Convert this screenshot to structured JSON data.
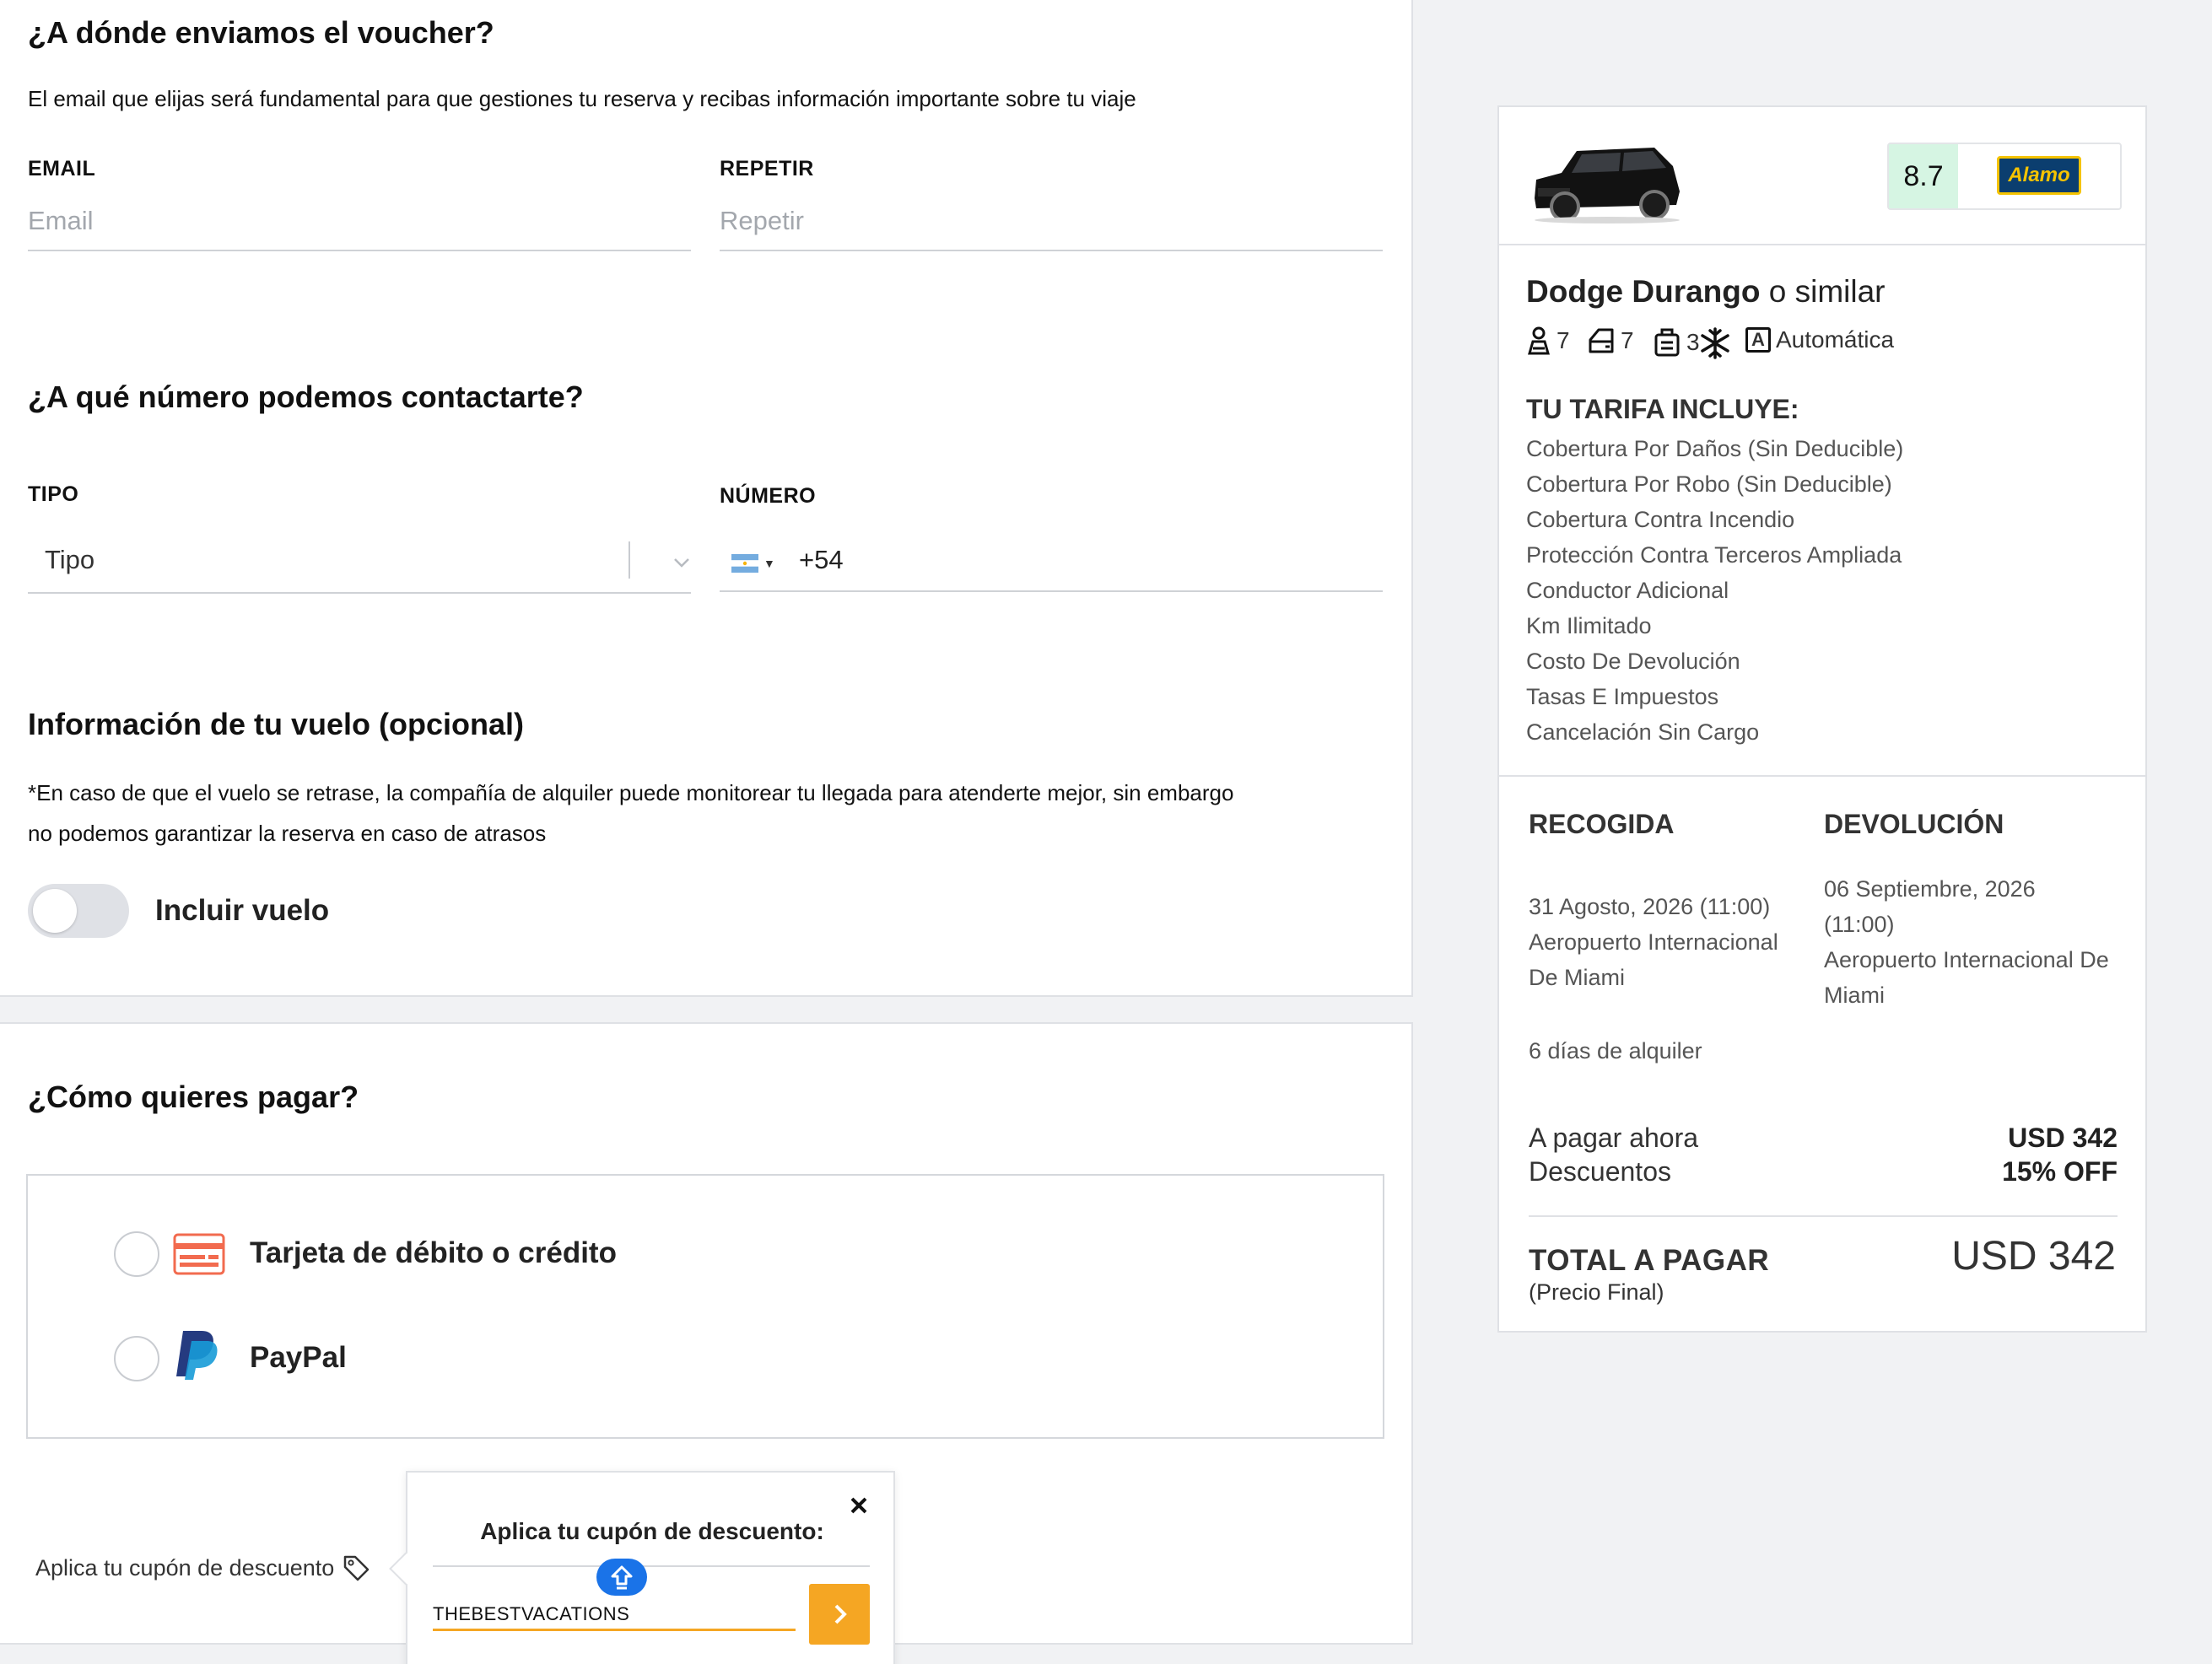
{
  "voucher": {
    "title": "¿A dónde enviamos el voucher?",
    "description": "El email que elijas será fundamental para que gestiones tu reserva y recibas información importante sobre tu viaje",
    "email_label": "EMAIL",
    "email_placeholder": "Email",
    "repeat_label": "REPETIR",
    "repeat_placeholder": "Repetir"
  },
  "contact": {
    "title": "¿A qué número podemos contactarte?",
    "type_label": "TIPO",
    "type_value": "Tipo",
    "number_label": "NÚMERO",
    "country_prefix": "+54"
  },
  "flight": {
    "title": "Información de tu vuelo (opcional)",
    "note_line1": "*En caso de que el vuelo se retrase, la compañía de alquiler puede monitorear tu llegada para atenderte mejor, sin embargo",
    "note_line2": "no podemos garantizar la reserva en caso de atrasos",
    "toggle_label": "Incluir vuelo",
    "toggle_on": false
  },
  "payment": {
    "title": "¿Cómo quieres pagar?",
    "options": [
      {
        "label": "Tarjeta de débito o crédito",
        "icon": "credit-card-icon"
      },
      {
        "label": "PayPal",
        "icon": "paypal-icon"
      }
    ]
  },
  "coupon": {
    "link_label": "Aplica tu cupón de descuento",
    "popover_title": "Aplica tu cupón de descuento:",
    "code_value": "THEBESTVACATIONS"
  },
  "summary": {
    "rating": "8.7",
    "vendor": "Alamo",
    "car_model": "Dodge Durango",
    "car_suffix": " o similar",
    "specs": {
      "passengers": "7",
      "doors": "7",
      "bags": "3",
      "transmission": "Automática",
      "transmission_badge": "A"
    },
    "includes_title": "TU TARIFA INCLUYE:",
    "includes": [
      "Cobertura Por Daños (Sin Deducible)",
      "Cobertura Por Robo (Sin Deducible)",
      "Cobertura Contra Incendio",
      "Protección Contra Terceros Ampliada",
      "Conductor Adicional",
      "Km Ilimitado",
      "Costo De Devolución",
      "Tasas E Impuestos",
      "Cancelación Sin Cargo"
    ],
    "pickup_title": "RECOGIDA",
    "pickup_date": "31 Agosto, 2026 (11:00)",
    "pickup_place": "Aeropuerto Internacional De Miami",
    "return_title": "DEVOLUCIÓN",
    "return_date": "06 Septiembre, 2026 (11:00)",
    "return_place": "Aeropuerto Internacional De Miami",
    "rental_days": "6 días de alquiler",
    "pay_now_label": "A pagar ahora",
    "pay_now_value": "USD 342",
    "discount_label": "Descuentos",
    "discount_value": "15% OFF",
    "total_label": "TOTAL A PAGAR",
    "total_sub": "(Precio Final)",
    "total_value": "USD 342"
  },
  "colors": {
    "accent": "#f5a623",
    "score_bg": "#d6f5e3",
    "card_icon": "#f26b4f",
    "paypal_dark": "#253b80",
    "paypal_light": "#179bd7"
  }
}
